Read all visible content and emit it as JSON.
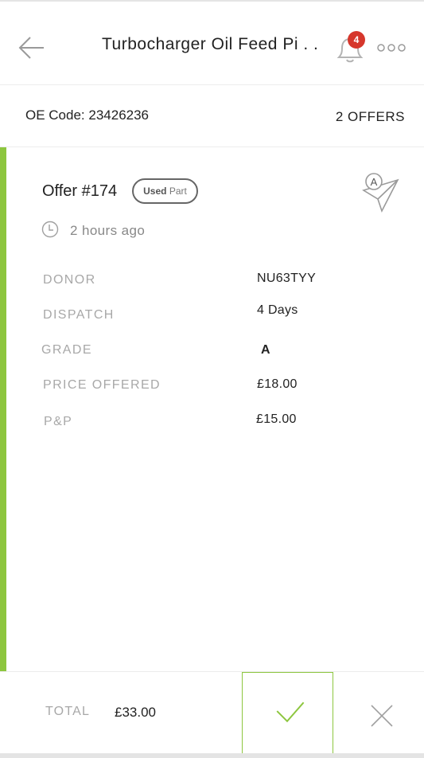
{
  "header": {
    "title": "Turbocharger Oil Feed Pi . . .",
    "notification_count": "4"
  },
  "oe": {
    "code_text": "OE Code: 23426236",
    "offers_count": "2 OFFERS"
  },
  "offer": {
    "title": "Offer #174",
    "tag_bold": "Used",
    "tag_rest": "Part",
    "time_ago": "2 hours ago",
    "grade_icon_letter": "A",
    "fields": [
      {
        "label": "DONOR",
        "value": "NU63TYY"
      },
      {
        "label": "DISPATCH",
        "value": "4 Days"
      },
      {
        "label": "GRADE",
        "value": "A"
      },
      {
        "label": "PRICE OFFERED",
        "value": "£18.00"
      },
      {
        "label": "P&P",
        "value": "£15.00"
      }
    ]
  },
  "footer": {
    "total_label": "TOTAL",
    "total_value": "£33.00"
  },
  "colors": {
    "accent": "#8dc63f",
    "badge": "#d6372c"
  },
  "icons": [
    "back-arrow-icon",
    "bell-icon",
    "more-dots-icon",
    "paper-plane-icon",
    "clock-icon",
    "check-icon",
    "close-icon"
  ]
}
